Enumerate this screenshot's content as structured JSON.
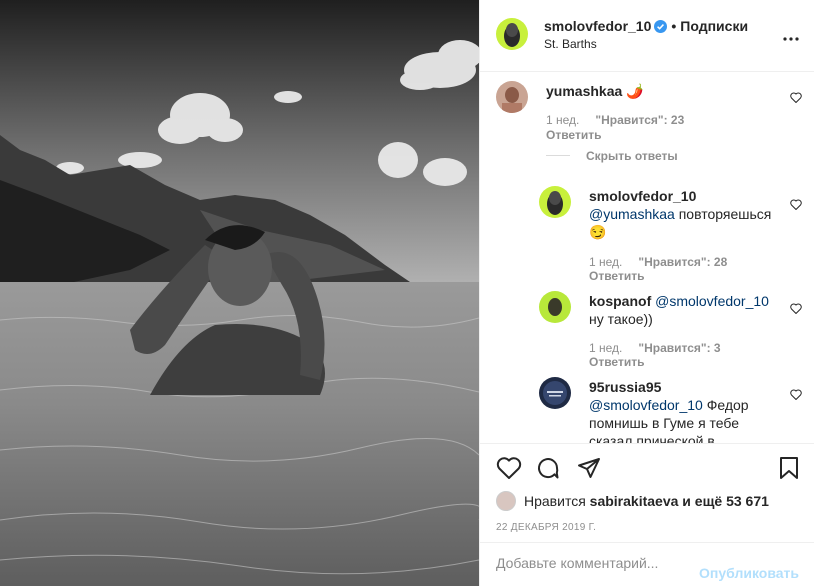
{
  "post": {
    "photo_alt": "Black and white photo of man in sea",
    "author": "smolovfedor_10",
    "separator": "•",
    "follow_label": "Подписки",
    "location": "St. Barths"
  },
  "comments": [
    {
      "user": "yumashkaa",
      "text": "🌶️",
      "time": "1 нед.",
      "likes": "\"Нравится\": 23",
      "reply": "Ответить"
    },
    {
      "user": "smolovfedor_10",
      "mention": "@yumashkaa",
      "text_line1": " повторяешься",
      "text_line2": "😏",
      "time": "1 нед.",
      "likes": "\"Нравится\": 28",
      "reply": "Ответить"
    },
    {
      "user": "kospanof",
      "mention": "@smolovfedor_10",
      "text_line2": "ну такое))",
      "time": "1 нед.",
      "likes": "\"Нравится\": 3",
      "reply": "Ответить"
    },
    {
      "user": "95russia95",
      "mention": "@smolovfedor_10",
      "text_line1": " Федор",
      "text_line2": "помнишь в Гуме я тебе",
      "text_line3": "сказал прической в"
    }
  ],
  "hide_replies": "Скрыть ответы",
  "likes": {
    "prefix": "Нравится ",
    "user": "sabirakitaeva",
    "suffix": " и ещё 53 671"
  },
  "date": "22 ДЕКАБРЯ 2019 Г.",
  "add_comment": {
    "placeholder": "Добавьте комментарий...",
    "publish": "Опубликовать"
  },
  "colors": {
    "accent": "#0095f6",
    "publish_disabled": "#b2dffc",
    "avatar_green": "#c8f03c"
  },
  "icons": [
    "heart-icon",
    "comment-icon",
    "share-icon",
    "bookmark-icon",
    "more-icon",
    "verified-badge-icon"
  ]
}
